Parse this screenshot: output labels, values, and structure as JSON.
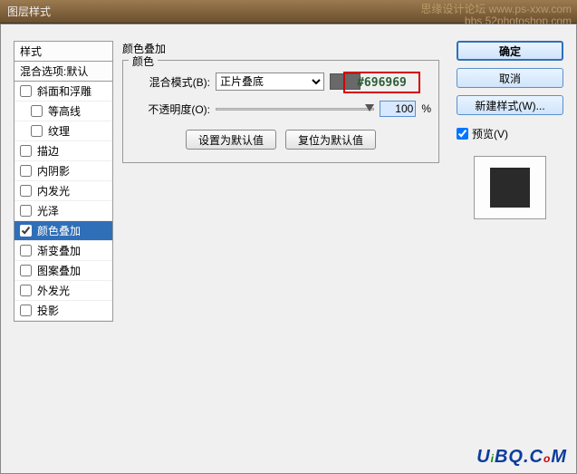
{
  "window": {
    "title": "图层样式"
  },
  "watermark": {
    "line1": "思缘设计论坛  www.ps-xxw.com",
    "line2": "bbs.52photoshop.com",
    "logo": "UiBQ.CoM"
  },
  "styles_panel": {
    "header": "样式",
    "subheader": "混合选项:默认",
    "items": [
      {
        "label": "斜面和浮雕",
        "checked": false,
        "indent": false
      },
      {
        "label": "等高线",
        "checked": false,
        "indent": true
      },
      {
        "label": "纹理",
        "checked": false,
        "indent": true
      },
      {
        "label": "描边",
        "checked": false,
        "indent": false
      },
      {
        "label": "内阴影",
        "checked": false,
        "indent": false
      },
      {
        "label": "内发光",
        "checked": false,
        "indent": false
      },
      {
        "label": "光泽",
        "checked": false,
        "indent": false
      },
      {
        "label": "颜色叠加",
        "checked": true,
        "indent": false,
        "selected": true
      },
      {
        "label": "渐变叠加",
        "checked": false,
        "indent": false
      },
      {
        "label": "图案叠加",
        "checked": false,
        "indent": false
      },
      {
        "label": "外发光",
        "checked": false,
        "indent": false
      },
      {
        "label": "投影",
        "checked": false,
        "indent": false
      }
    ]
  },
  "main": {
    "title": "颜色叠加",
    "group_label": "颜色",
    "blend_mode_label": "混合模式(B):",
    "blend_mode_value": "正片叠底",
    "color_hex": "#696969",
    "opacity_label": "不透明度(O):",
    "opacity_value": "100",
    "opacity_unit": "%",
    "btn_default": "设置为默认值",
    "btn_reset": "复位为默认值"
  },
  "right": {
    "ok": "确定",
    "cancel": "取消",
    "new_style": "新建样式(W)...",
    "preview_label": "预览(V)",
    "preview_checked": true
  },
  "callout": {
    "text": "#696969"
  }
}
